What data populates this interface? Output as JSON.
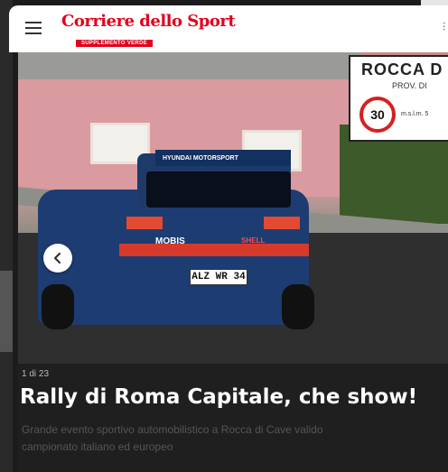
{
  "header": {
    "logo_name": "Corriere dello Sport",
    "logo_tagline": "SUPPLEMENTO VERDE",
    "brand_color": "#e3001b"
  },
  "photo": {
    "sign_title": "ROCCA D",
    "sign_prov": "PROV. DI",
    "sign_limit": "30",
    "sign_small": "m.s.l.m. 5",
    "car_brand": "HYUNDAI MOTORSPORT",
    "car_sponsor1": "MOBIS",
    "car_sponsor2": "SHELL",
    "plate": "ALZ WR 34"
  },
  "gallery": {
    "counter": "1 di 23",
    "headline": "Rally di Roma Capitale, che show!",
    "description_line1": "Grande evento sportivo automobilistico a Rocca di Cave valido",
    "description_line2": "campionato italiano ed europeo"
  }
}
